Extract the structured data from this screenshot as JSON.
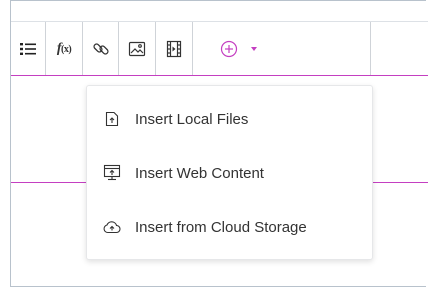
{
  "toolbar": {
    "buttons": [
      {
        "name": "bulleted-list",
        "icon": "list-icon"
      },
      {
        "name": "formula",
        "icon": "function-icon",
        "label_main": "f",
        "label_sub": "(x)"
      },
      {
        "name": "link",
        "icon": "link-icon"
      },
      {
        "name": "image",
        "icon": "image-icon"
      },
      {
        "name": "video",
        "icon": "video-icon"
      },
      {
        "name": "insert",
        "icon": "plus-circle-icon",
        "dropdown_icon": "caret-down-icon"
      }
    ],
    "accent_color": "#c43fc1"
  },
  "insert_menu": {
    "items": [
      {
        "label": "Insert Local Files",
        "icon": "file-upload-icon"
      },
      {
        "label": "Insert Web Content",
        "icon": "web-content-icon"
      },
      {
        "label": "Insert from Cloud Storage",
        "icon": "cloud-upload-icon"
      }
    ]
  }
}
